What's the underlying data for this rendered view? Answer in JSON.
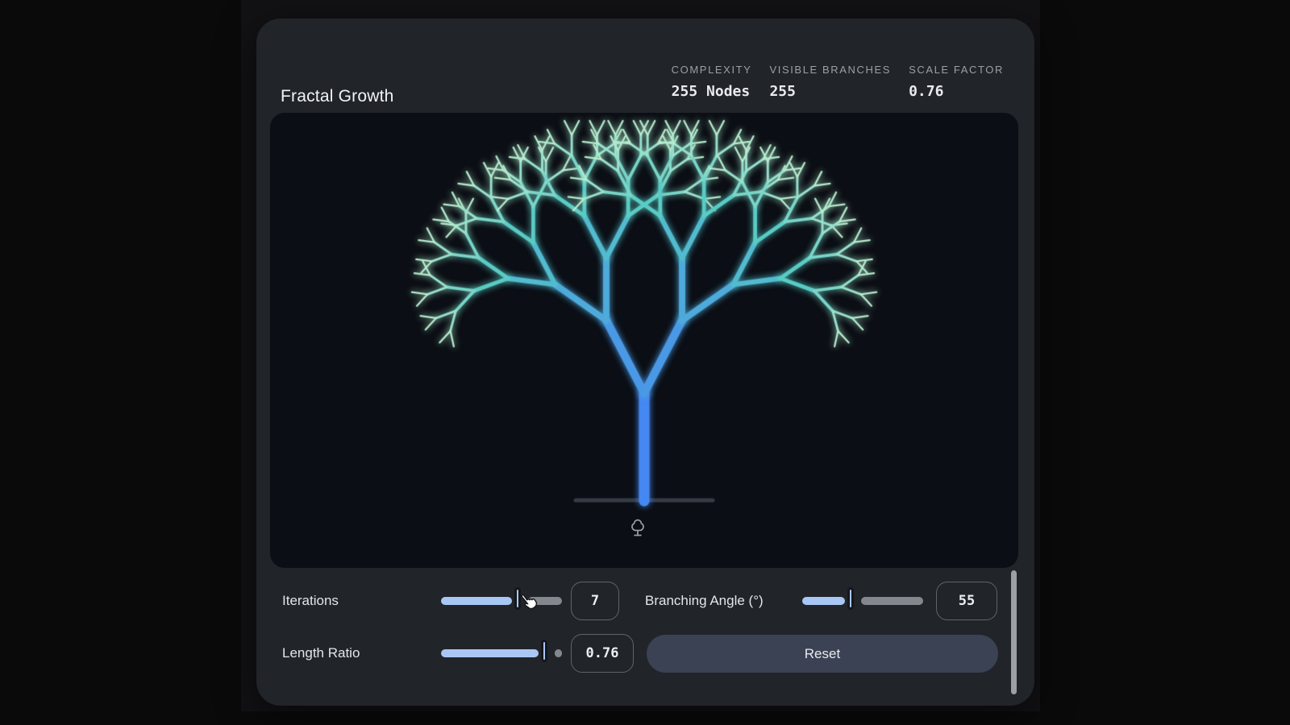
{
  "header": {
    "title": "Fractal Growth",
    "stats": [
      {
        "label": "COMPLEXITY",
        "value": "255 Nodes"
      },
      {
        "label": "VISIBLE BRANCHES",
        "value": "255"
      },
      {
        "label": "SCALE FACTOR",
        "value": "0.76"
      }
    ]
  },
  "controls": {
    "iterations": {
      "label": "Iterations",
      "value": "7",
      "fill_pct": 65
    },
    "branching_angle": {
      "label": "Branching Angle (°)",
      "value": "55",
      "fill_pct": 42
    },
    "length_ratio": {
      "label": "Length Ratio",
      "value": "0.76",
      "fill_pct": 87
    },
    "reset_label": "Reset"
  },
  "fractal": {
    "iterations": 7,
    "branching_angle_deg": 55,
    "length_ratio": 0.76,
    "trunk_color": "#4688f2",
    "mid_color": "#55c9c5",
    "tip_color": "#b5eccf",
    "ground_color": "#363b46"
  },
  "colors": {
    "accent_blue": "#a9c7f4",
    "card": "#212429",
    "canvas": "#0b0e14",
    "reset_button": "#3b4254"
  },
  "icons": {
    "tree_marker": "tree-icon",
    "mouse_cursor": "hand-pointer-icon"
  }
}
